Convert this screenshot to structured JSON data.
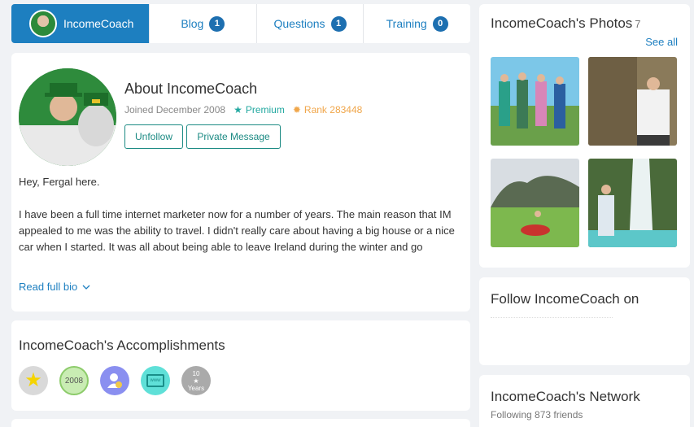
{
  "tabs": {
    "user": "IncomeCoach",
    "items": [
      {
        "label": "Blog",
        "count": "1"
      },
      {
        "label": "Questions",
        "count": "1"
      },
      {
        "label": "Training",
        "count": "0"
      }
    ]
  },
  "about": {
    "title": "About IncomeCoach",
    "joined": "Joined December 2008",
    "premium": "Premium",
    "rank": "Rank 283448",
    "unfollow": "Unfollow",
    "message": "Private Message",
    "bio_p1": "Hey, Fergal here.",
    "bio_p2": "I have been a full time internet marketer now for a number of years. The main reason that IM appealed to me was the ability to travel. I didn't really care about having a big house or a nice car when I started. It was all about being able to leave Ireland during the winter and go",
    "read_full": "Read full bio"
  },
  "accomplishments": {
    "title": "IncomeCoach's Accomplishments",
    "badges": [
      {
        "name": "star",
        "label": "",
        "color": "#f5d400"
      },
      {
        "name": "year",
        "label": "2008",
        "color": "#b8e6a0"
      },
      {
        "name": "user",
        "label": "",
        "color": "#8a8ff0"
      },
      {
        "name": "www",
        "label": "www",
        "color": "#5fe0d8"
      },
      {
        "name": "years",
        "label": "10",
        "sub": "Years",
        "color": "#aaaaaa"
      }
    ]
  },
  "photos": {
    "title": "IncomeCoach's Photos",
    "count": "7",
    "see_all": "See all"
  },
  "follow": {
    "title": "Follow IncomeCoach on"
  },
  "network": {
    "title": "IncomeCoach's Network",
    "following": "Following 873 friends"
  },
  "colors": {
    "accent": "#1d7fc0",
    "teal": "#1b8a83",
    "rank": "#f0a64a"
  }
}
